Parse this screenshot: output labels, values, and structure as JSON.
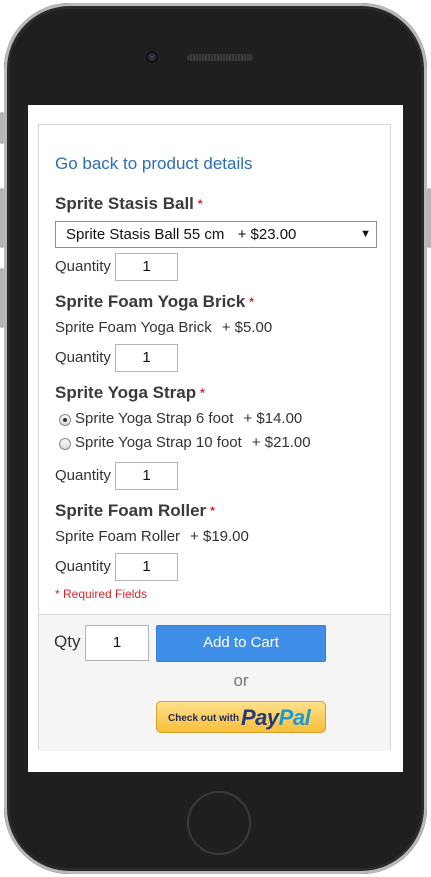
{
  "product_options": {
    "back_link": "Go back to product details",
    "quantity_label": "Quantity",
    "required_star": "*",
    "sections": [
      {
        "title": "Sprite Stasis Ball",
        "select": {
          "selected_name": "Sprite Stasis Ball 55 cm",
          "selected_price": "+ $23.00"
        },
        "quantity": "1"
      },
      {
        "title": "Sprite Foam Yoga Brick",
        "item": {
          "name": "Sprite Foam Yoga Brick",
          "price": "+ $5.00"
        },
        "quantity": "1"
      },
      {
        "title": "Sprite Yoga Strap",
        "radios": [
          {
            "name": "Sprite Yoga Strap 6 foot",
            "price": "+ $14.00",
            "checked": true
          },
          {
            "name": "Sprite Yoga Strap 10 foot",
            "price": "+ $21.00",
            "checked": false
          }
        ],
        "quantity": "1"
      },
      {
        "title": "Sprite Foam Roller",
        "item": {
          "name": "Sprite Foam Roller",
          "price": "+ $19.00"
        },
        "quantity": "1"
      }
    ],
    "required_note": "* Required Fields"
  },
  "cart": {
    "qty_label": "Qty",
    "qty_value": "1",
    "add_to_cart_label": "Add to Cart",
    "or_label": "or",
    "paypal": {
      "checkout_text": "Check out with",
      "brand_pay": "Pay",
      "brand_pal": "Pal"
    }
  },
  "colors": {
    "link": "#2d6db5",
    "required": "#d9262b",
    "button_primary": "#3f8fe8",
    "paypal_gold": "#f7bf3b"
  },
  "icons": {
    "select_arrow": "dropdown-arrow-icon"
  }
}
